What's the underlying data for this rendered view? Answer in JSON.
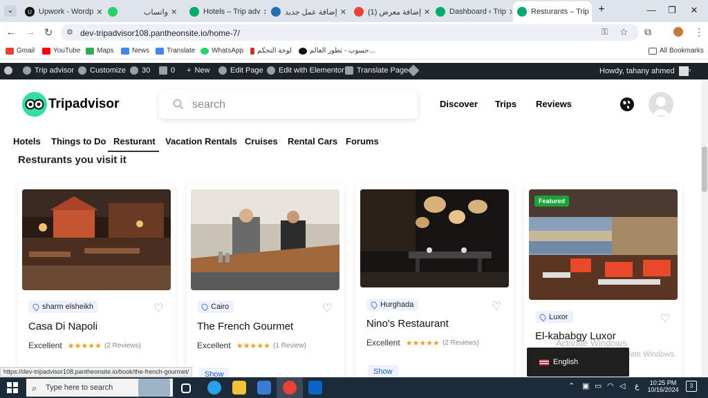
{
  "browser": {
    "tabs": [
      {
        "label": "Upwork - Wordp",
        "icon": "upwork-icon"
      },
      {
        "label": "",
        "icon": "whatsapp-icon"
      },
      {
        "label": "واتساب",
        "icon": "whatsapp-icon"
      },
      {
        "label": "Hotels – Trip adv",
        "icon": "tripadvisor-icon"
      },
      {
        "label": "إضافة عمل جديد",
        "icon": "wordpress-icon"
      },
      {
        "label": "(1) إضافة معرض",
        "icon": "google-icon"
      },
      {
        "label": "Dashboard ‹ Trip",
        "icon": "tripadvisor-icon"
      },
      {
        "label": "Resturants – Trip",
        "icon": "tripadvisor-icon",
        "active": true
      }
    ],
    "url": "dev-tripadvisor108.pantheonsite.io/home-7/",
    "bookmarks": [
      {
        "label": "Gmail",
        "icon": "gmail-icon"
      },
      {
        "label": "YouTube",
        "icon": "youtube-icon"
      },
      {
        "label": "Maps",
        "icon": "maps-icon"
      },
      {
        "label": "News",
        "icon": "news-icon"
      },
      {
        "label": "Translate",
        "icon": "translate-icon"
      },
      {
        "label": "WhatsApp",
        "icon": "whatsapp-icon"
      },
      {
        "label": "لوحة التحكم",
        "icon": "dashboard-icon"
      },
      {
        "label": "حسوب - تطور العالم...",
        "icon": "hsoub-icon"
      }
    ],
    "all_bookmarks": "All Bookmarks"
  },
  "wp_admin_bar": {
    "site_name": "Trip advisor",
    "customize": "Customize",
    "updates": "30",
    "comments": "0",
    "new": "New",
    "edit_page": "Edit Page",
    "elementor": "Edit with Elementor",
    "translate": "Translate Page",
    "howdy": "Howdy, tahany ahmed"
  },
  "site": {
    "logo_text": "Tripadvisor",
    "search_placeholder": "search",
    "nav": [
      "Discover",
      "Trips",
      "Reviews"
    ],
    "categories": [
      "Hotels",
      "Things to Do",
      "Resturant",
      "Vacation Rentals",
      "Cruises",
      "Rental Cars",
      "Forums"
    ],
    "active_category": "Resturant",
    "section_title": "Resturants you visit it"
  },
  "cards": [
    {
      "location": "sharm elsheikh",
      "name": "Casa Di Napoli",
      "rating_label": "Excellent",
      "stars": 5,
      "reviews": "(2 Reviews)",
      "button": "",
      "featured": ""
    },
    {
      "location": "Cairo",
      "name": "The French Gourmet",
      "rating_label": "Excellent",
      "stars": 5,
      "reviews": "(1 Review)",
      "button": "Show",
      "featured": ""
    },
    {
      "location": "Hurghada",
      "name": "Nino's Restaurant",
      "rating_label": "Excellent",
      "stars": 5,
      "reviews": "(2 Reviews)",
      "button": "Show",
      "featured": ""
    },
    {
      "location": "Luxor",
      "name": "El-kababgy Luxor",
      "rating_label": "",
      "stars": 0,
      "reviews": "",
      "button": "",
      "featured": "Featured"
    }
  ],
  "status_url": "https://dev-tripadvisor108.pantheonsite.io/book/the-french-gourmet/",
  "language_switcher": "English",
  "watermark": {
    "line1": "Activate Windows",
    "line2": "Go to Settings to activate Windows."
  },
  "taskbar": {
    "search_placeholder": "Type here to search",
    "time": "10:25 PM",
    "date": "10/16/2024",
    "lang": "ع",
    "notifications": "3"
  },
  "colors": {
    "brand": "#34e0a1",
    "featured": "#1ba33a",
    "wp_bar": "#1d2327",
    "star": "#f0a020"
  }
}
